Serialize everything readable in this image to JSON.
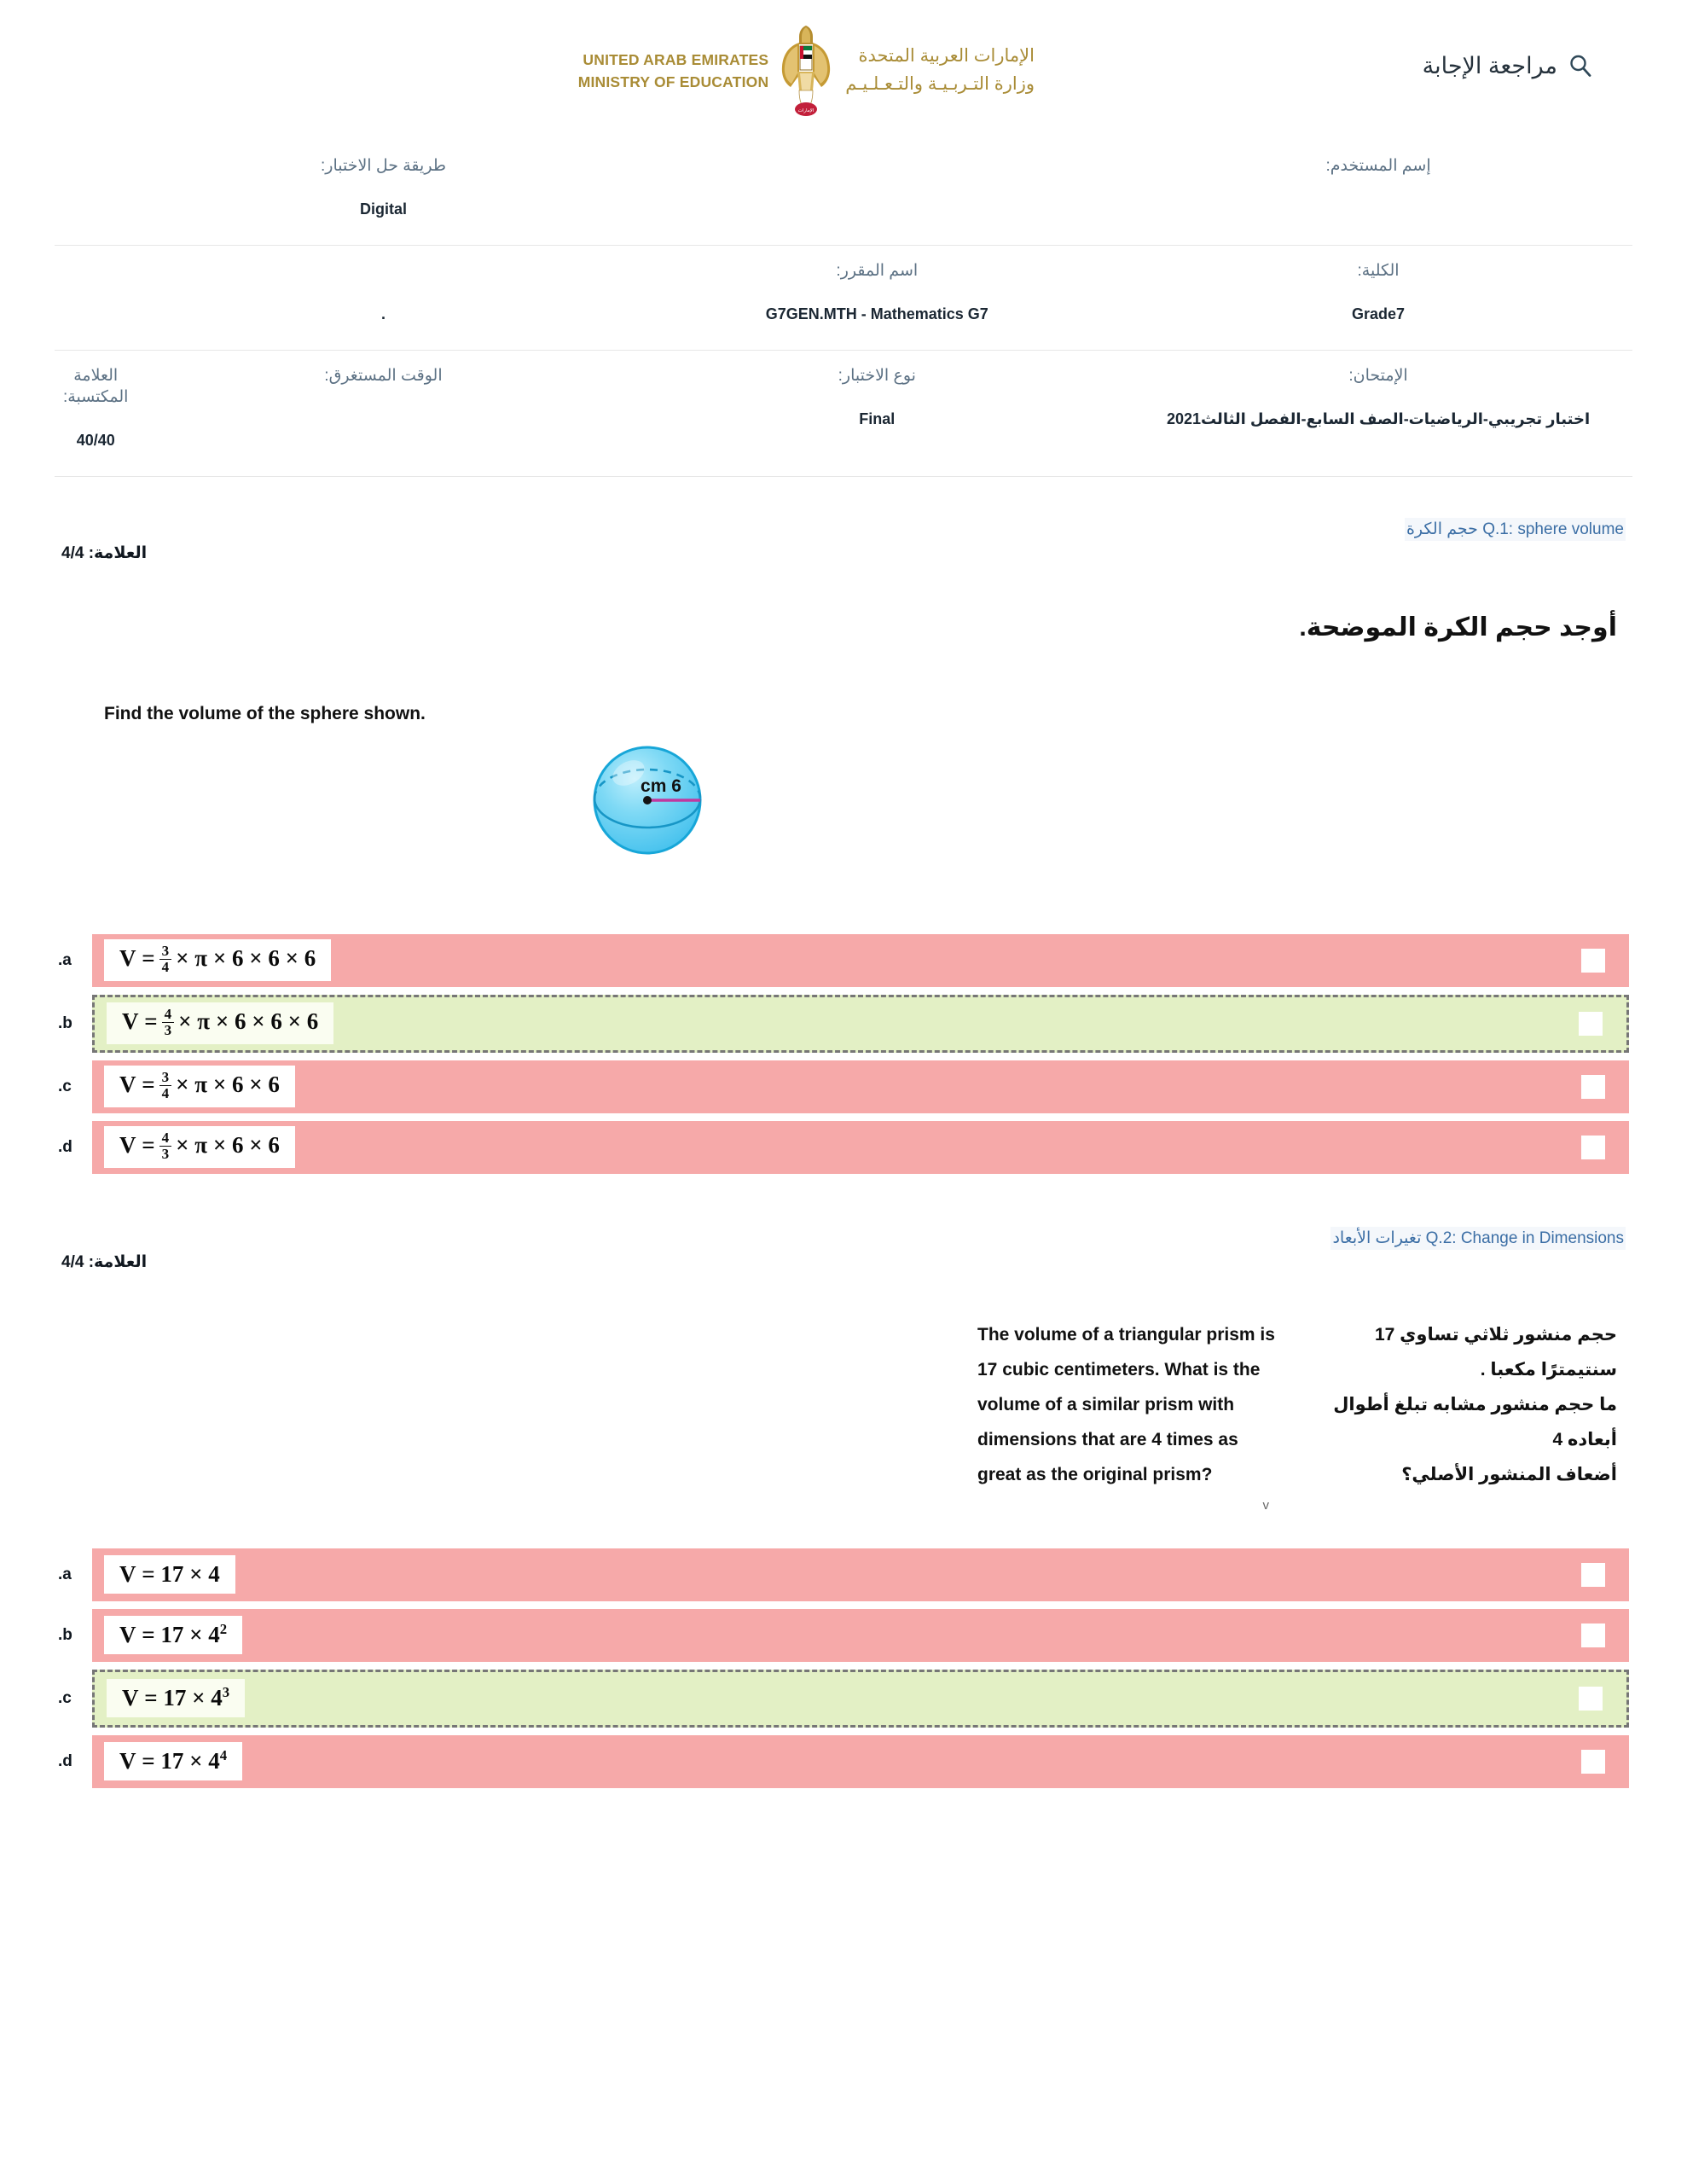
{
  "header": {
    "review_label": "مراجعة الإجابة",
    "search_icon": "search-icon",
    "logo": {
      "en_line1": "UNITED ARAB EMIRATES",
      "en_line2": "MINISTRY OF EDUCATION",
      "ar_line1": "الإمارات العربية المتحدة",
      "ar_line2": "وزارة التـربـيـة والتـعـلـيـم",
      "emblem": "uae-falcon-emblem-icon"
    }
  },
  "info": {
    "row1": {
      "username_label": "إسم المستخدم:",
      "username_value": "",
      "method_label": "طريقة حل الاختبار:",
      "method_value": "Digital"
    },
    "row2": {
      "college_label": "الكلية:",
      "college_value": "Grade7",
      "course_label": "اسم المقرر:",
      "course_value": "G7GEN.MTH - Mathematics G7",
      "extra_value": "."
    },
    "row3": {
      "exam_label": "الإمتحان:",
      "exam_value": "اختبار تجريبي-الرياضيات-الصف السابع-الفصل الثالث2021",
      "type_label": "نوع الاختبار:",
      "type_value": "Final",
      "time_label": "الوقت المستغرق:",
      "time_value": "",
      "score_label": "العلامة المكتسبة:",
      "score_value": "40/40"
    }
  },
  "questions": [
    {
      "title": "Q.1: sphere volume حجم الكرة",
      "mark": "العلامة: 4/4",
      "stem_ar": "أوجد حجم الكرة الموضحة.",
      "stem_en": "Find the volume of the sphere shown.",
      "figure": {
        "type": "sphere",
        "radius_label": "6 cm",
        "fill_color": "#6fd3f2",
        "stroke_color": "#1da7d6",
        "radius_line_color": "#c0399f"
      },
      "options": [
        {
          "letter": ".a",
          "text": "V = 3/4 × π × 6 × 6 × 6",
          "correct": false,
          "parts": {
            "lead": "V =",
            "num": "3",
            "den": "4",
            "tail": "× π × 6 × 6 × 6"
          }
        },
        {
          "letter": ".b",
          "text": "V = 4/3 × π × 6 × 6 × 6",
          "correct": true,
          "parts": {
            "lead": "V =",
            "num": "4",
            "den": "3",
            "tail": "× π × 6 × 6 × 6"
          }
        },
        {
          "letter": ".c",
          "text": "V = 3/4 × π × 6 × 6",
          "correct": false,
          "parts": {
            "lead": "V =",
            "num": "3",
            "den": "4",
            "tail": "× π × 6 × 6"
          }
        },
        {
          "letter": ".d",
          "text": "V = 4/3 × π × 6 × 6",
          "correct": false,
          "parts": {
            "lead": "V =",
            "num": "4",
            "den": "3",
            "tail": "× π × 6 × 6"
          }
        }
      ]
    },
    {
      "title": "Q.2: Change in Dimensions تغيرات الأبعاد",
      "mark": "العلامة: 4/4",
      "stem_ar_line1": "حجم منشور ثلاثي تساوي 17 سنتيمترًا مكعبا  .",
      "stem_ar_line2": "ما حجم منشور مشابه تبلغ أطوال أبعاده 4",
      "stem_ar_line3": "أضعاف المنشور الأصلي؟",
      "stem_en_line1": "The volume of a triangular prism is",
      "stem_en_line2": "17 cubic centimeters. What is the",
      "stem_en_line3": "volume of a similar prism with",
      "stem_en_line4": "dimensions that are 4 times as",
      "stem_en_line5": "great as the original prism?",
      "marker": "v",
      "options": [
        {
          "letter": ".a",
          "text": "V = 17 × 4",
          "correct": false,
          "parts": {
            "base": "V = 17 × 4",
            "exp": ""
          }
        },
        {
          "letter": ".b",
          "text": "V = 17 × 4²",
          "correct": false,
          "parts": {
            "base": "V = 17 × 4",
            "exp": "2"
          }
        },
        {
          "letter": ".c",
          "text": "V = 17 × 4³",
          "correct": true,
          "parts": {
            "base": "V = 17 × 4",
            "exp": "3"
          }
        },
        {
          "letter": ".d",
          "text": "V = 17 × 4⁴",
          "correct": false,
          "parts": {
            "base": "V = 17 × 4",
            "exp": "4"
          }
        }
      ]
    }
  ],
  "colors": {
    "wrong_option": "#f6a9a9",
    "correct_option": "#e3f0c5",
    "title_blue": "#3b6ea5",
    "label_gray": "#5c7184",
    "logo_gold": "#a98c36"
  }
}
